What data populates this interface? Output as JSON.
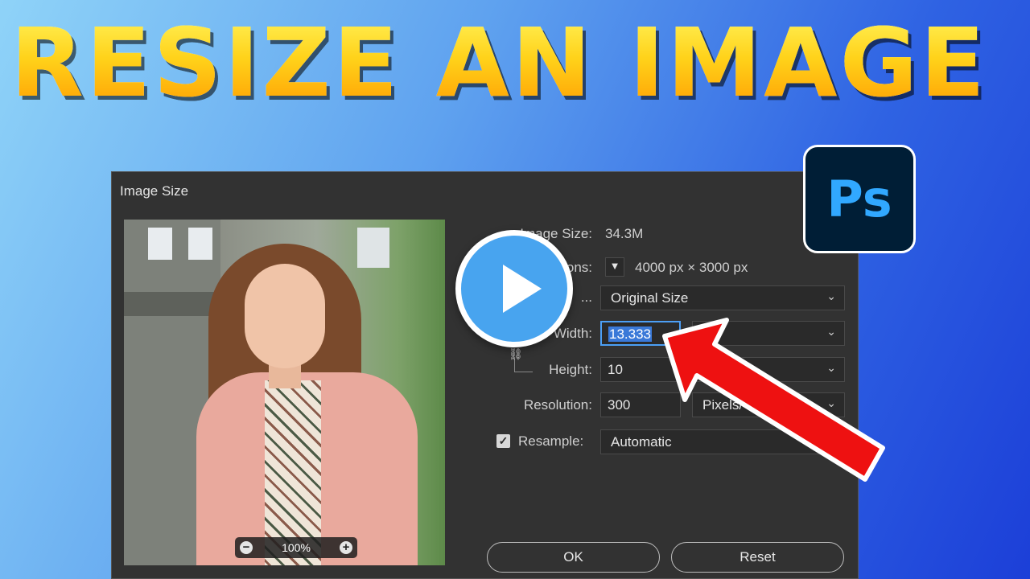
{
  "headline": "RESIZE AN IMAGE",
  "logo": {
    "text": "Ps",
    "icon": "photoshop-logo-icon",
    "bg": "#001e36",
    "fg": "#31a8ff"
  },
  "dialog": {
    "title": "Image Size",
    "image_size_label": "Image Size:",
    "image_size_value": "34.3M",
    "dimensions_label": "ons:",
    "dimensions_value": "4000 px  ×  3000 px",
    "fit_to_label": "...",
    "fit_to_value": "Original Size",
    "width_label": "Width:",
    "width_value": "13.333",
    "width_unit": "I",
    "height_label": "Height:",
    "height_value": "10",
    "resolution_label": "Resolution:",
    "resolution_value": "300",
    "resolution_unit": "Pixels/",
    "resample_label": "Resample:",
    "resample_checked": true,
    "resample_value": "Automatic",
    "zoom_level": "100%",
    "ok_label": "OK",
    "reset_label": "Reset"
  },
  "overlay": {
    "play_icon": "play-icon",
    "arrow_icon": "red-arrow-icon",
    "arrow_color": "#ee1111",
    "play_color": "#48a4ef"
  }
}
